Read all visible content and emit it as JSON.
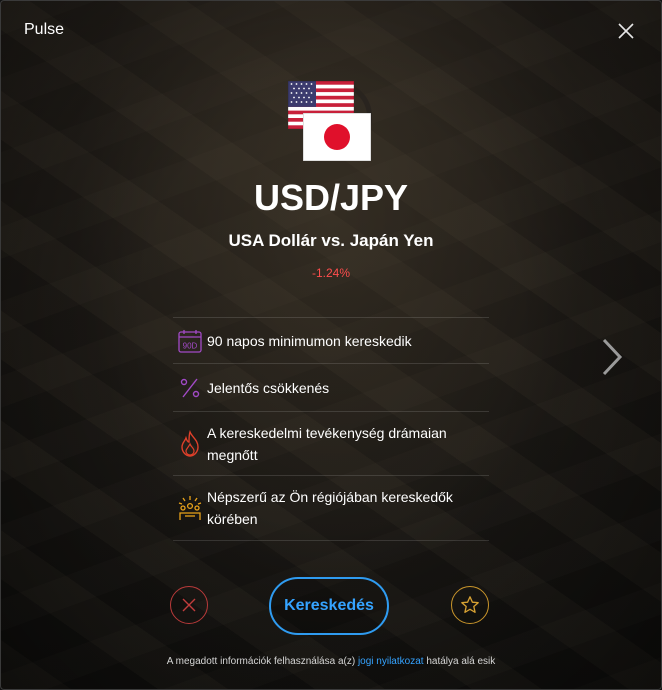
{
  "window": {
    "title": "Pulse"
  },
  "asset": {
    "pair": "USD/JPY",
    "name": "USA Dollár vs. Japán Yen",
    "change": "-1.24%",
    "change_color": "#ff4d4d"
  },
  "insights": [
    {
      "icon": "calendar-90d-icon",
      "icon_text": "90D",
      "text": "90 napos minimumon kereskedik"
    },
    {
      "icon": "percent-icon",
      "text": "Jelentős csökkenés"
    },
    {
      "icon": "fire-icon",
      "text": "A kereskedelmi tevékenység drámaian megnőtt"
    },
    {
      "icon": "crowd-icon",
      "text": "Népszerű az Ön régiójában kereskedők körében"
    }
  ],
  "actions": {
    "trade_label": "Kereskedés",
    "trade_color": "#2f9bf0",
    "dismiss_color": "#b83a3a",
    "favorite_color": "#c9952b"
  },
  "footer": {
    "prefix": "A megadott információk felhasználása a(z) ",
    "link": "jogi nyilatkozat",
    "suffix": " hatálya alá esik"
  }
}
